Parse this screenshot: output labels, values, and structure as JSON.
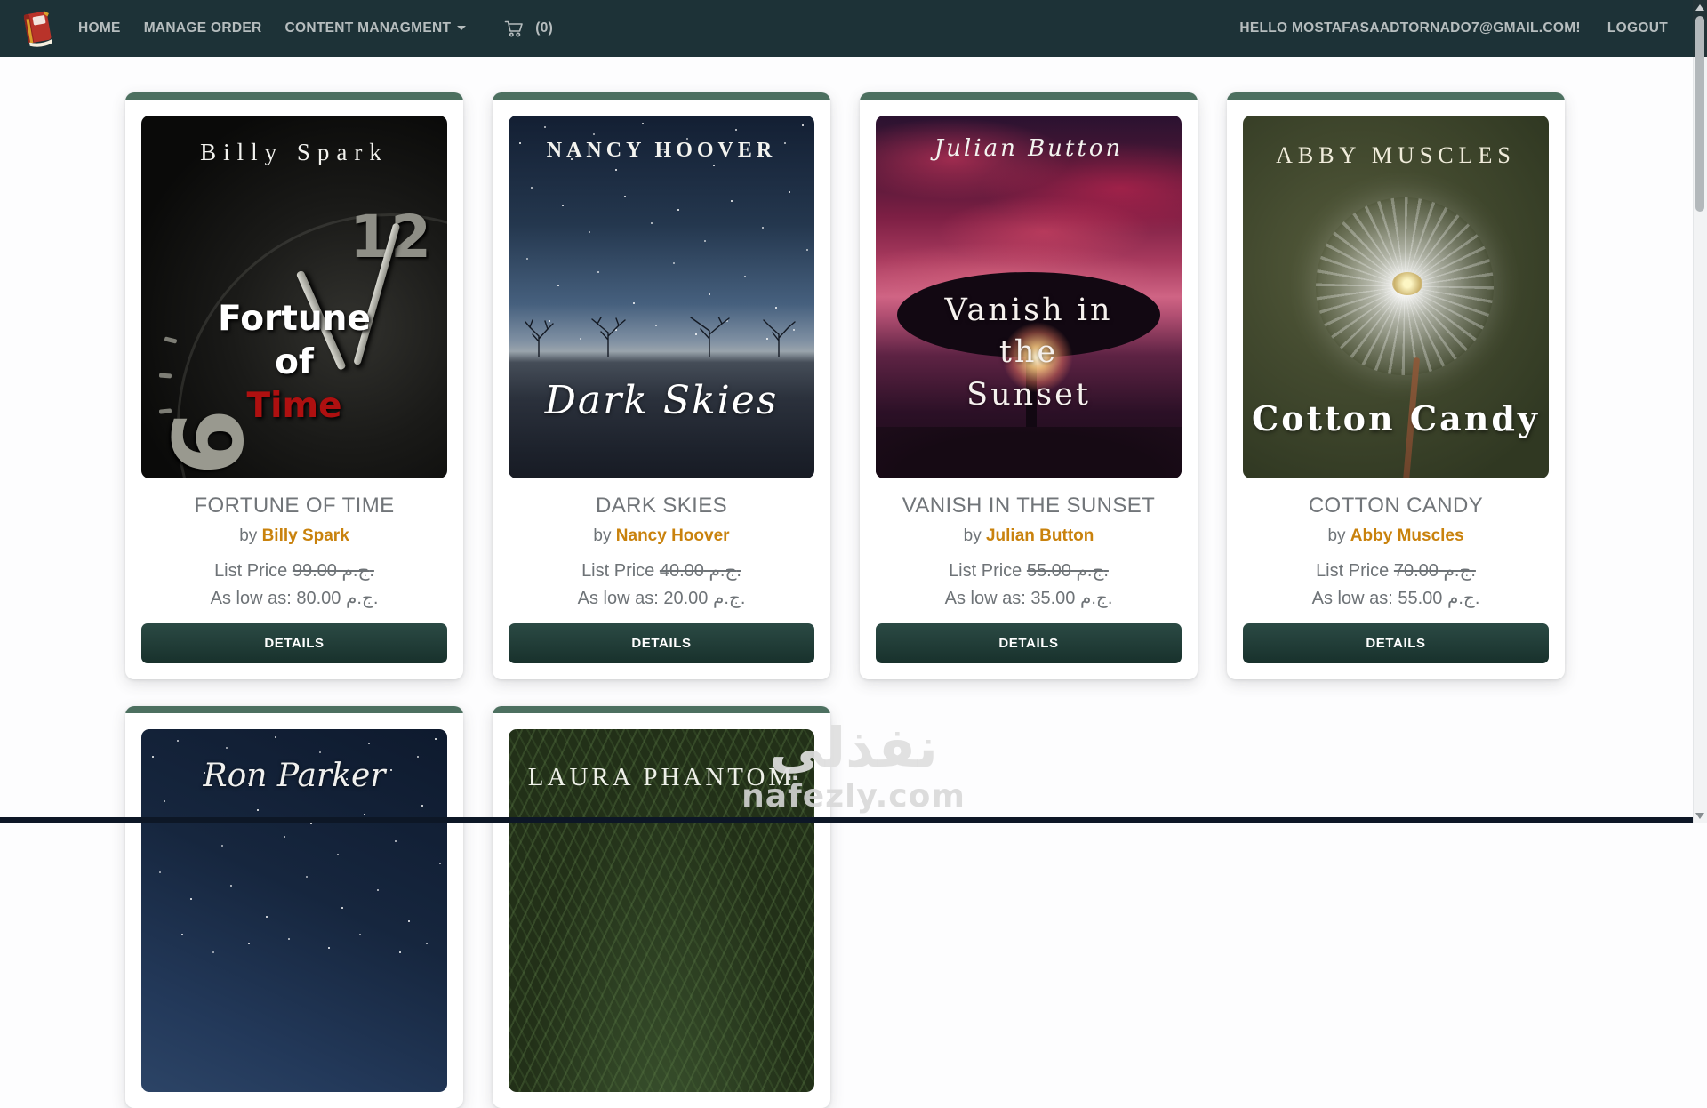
{
  "navbar": {
    "logo_icon": "book-logo",
    "items": [
      {
        "label": "HOME"
      },
      {
        "label": "MANAGE ORDER"
      },
      {
        "label": "CONTENT MANAGMENT",
        "has_caret": true
      }
    ],
    "cart_icon": "cart-icon",
    "cart_count_label": "(0)",
    "greeting": "HELLO MOSTAFASAADTORNADO7@GMAIL.COM!",
    "logout_label": "LOGOUT"
  },
  "labels": {
    "by": "by",
    "list_price": "List Price",
    "as_low_as": "As low as:",
    "currency": "ج.م.",
    "details": "DETAILS"
  },
  "colors": {
    "navbar_bg": "#1d3237",
    "card_strip_green": "#4d7060",
    "button_dark_teal": "#1f3b35",
    "author_orange": "#c9820d",
    "title_gray": "#717579",
    "cover1_red_word": "#ae1010"
  },
  "books": [
    {
      "title": "FORTUNE OF TIME",
      "author": "Billy Spark",
      "list_price": "99.00",
      "low_price": "80.00",
      "cover": {
        "author": "Billy Spark",
        "line1": "Fortune",
        "line2": "of",
        "line3": "Time",
        "numeral_12": "12",
        "numeral_9": "9"
      }
    },
    {
      "title": "DARK SKIES",
      "author": "Nancy Hoover",
      "list_price": "40.00",
      "low_price": "20.00",
      "cover": {
        "author": "NANCY HOOVER",
        "script_title": "Dark Skies"
      }
    },
    {
      "title": "VANISH IN THE SUNSET",
      "author": "Julian Button",
      "list_price": "55.00",
      "low_price": "35.00",
      "cover": {
        "author": "Julian Button",
        "line1": "Vanish in",
        "line2": "the",
        "line3": "Sunset"
      }
    },
    {
      "title": "COTTON CANDY",
      "author": "Abby Muscles",
      "list_price": "70.00",
      "low_price": "55.00",
      "cover": {
        "author": "ABBY MUSCLES",
        "title": "Cotton Candy"
      }
    }
  ],
  "partial_books": [
    {
      "cover_text": "Ron Parker"
    },
    {
      "cover_text": "LAURA PHANTOM"
    }
  ],
  "watermark": {
    "arabic": "نفذلي",
    "latin": "nafezly.com"
  }
}
